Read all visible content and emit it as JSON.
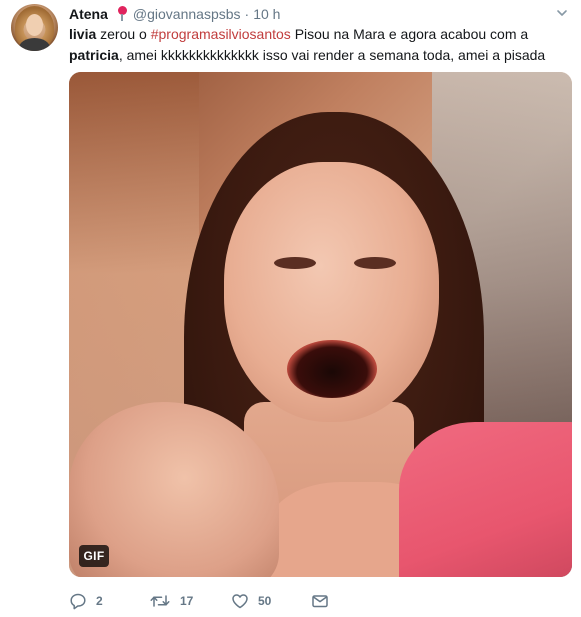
{
  "tweet": {
    "author_name": "Atena",
    "handle": "@giovannaspsbs",
    "separator": "·",
    "time": "10 h",
    "text": {
      "part1_bold": "livia",
      "part2": " zerou o ",
      "hashtag": "#programasilviosantos",
      "part3": " Pisou na Mara e agora acabou com a ",
      "part4_bold": "patricia",
      "part5": ", amei kkkkkkkkkkkkkk isso vai render a semana toda, amei a pisada"
    },
    "media_badge": "GIF",
    "actions": {
      "reply_count": "2",
      "retweet_count": "17",
      "like_count": "50"
    }
  },
  "icons": {
    "pin": "pin-icon",
    "caret": "chevron-down-icon",
    "reply": "reply-icon",
    "retweet": "retweet-icon",
    "like": "heart-icon",
    "dm": "envelope-icon"
  },
  "colors": {
    "hashtag": "#c13d3d",
    "secondary_text": "#657786",
    "pin": "#e0245e"
  }
}
